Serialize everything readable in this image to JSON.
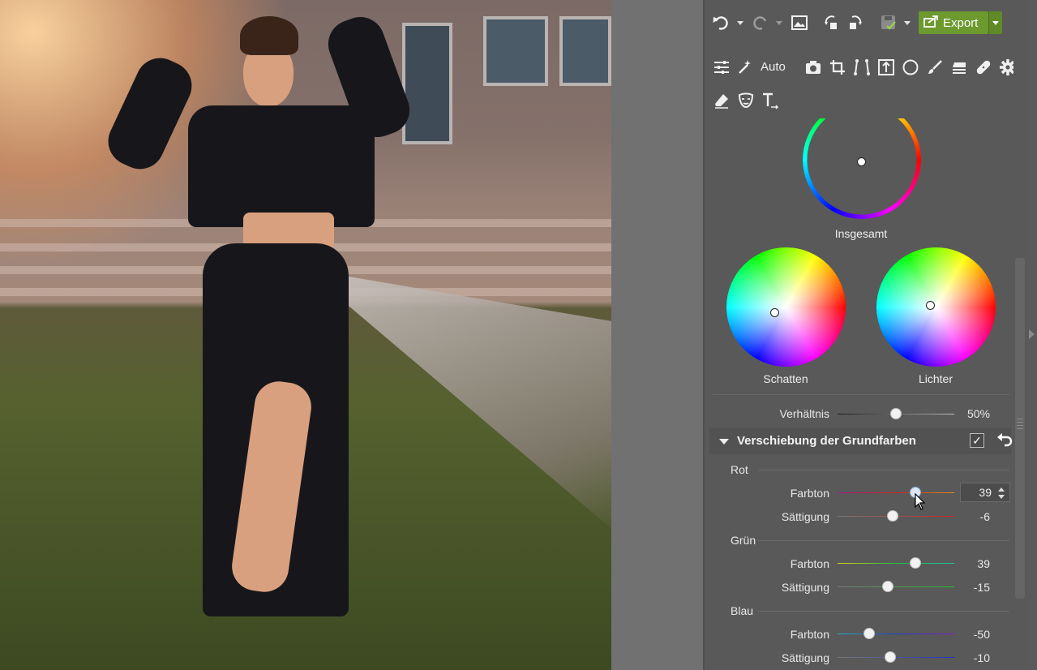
{
  "toolbar": {
    "export_label": "Export",
    "auto_label": "Auto",
    "icons": [
      "undo-icon",
      "redo-icon",
      "image-icon",
      "rotate-left-icon",
      "rotate-right-icon",
      "save-icon",
      "export-icon"
    ],
    "tools": [
      "adjustments-icon",
      "magic-wand-icon",
      "camera-icon",
      "crop-icon",
      "perspective-icon",
      "frame-icon",
      "circle-filter-icon",
      "brush-icon",
      "gradient-icon",
      "bandage-icon",
      "gear-icon",
      "eraser-icon",
      "mask-icon",
      "text-icon"
    ],
    "accent": "#6c9a2e"
  },
  "color_wheels": {
    "overall_label": "Insgesamt",
    "shadows_label": "Schatten",
    "highlights_label": "Lichter"
  },
  "ratio": {
    "label": "Verhältnis",
    "value": "50%",
    "fraction": 0.5
  },
  "section": {
    "title": "Verschiebung der Grundfarben",
    "check": "✓",
    "groups": [
      {
        "title": "Rot",
        "hue_label": "Farbton",
        "hue_value": "39",
        "hue_fraction": 0.67,
        "sat_label": "Sättigung",
        "sat_value": "-6",
        "sat_fraction": 0.47
      },
      {
        "title": "Grün",
        "hue_label": "Farbton",
        "hue_value": "39",
        "hue_fraction": 0.67,
        "sat_label": "Sättigung",
        "sat_value": "-15",
        "sat_fraction": 0.43
      },
      {
        "title": "Blau",
        "hue_label": "Farbton",
        "hue_value": "-50",
        "hue_fraction": 0.27,
        "sat_label": "Sättigung",
        "sat_value": "-10",
        "sat_fraction": 0.45
      }
    ]
  }
}
